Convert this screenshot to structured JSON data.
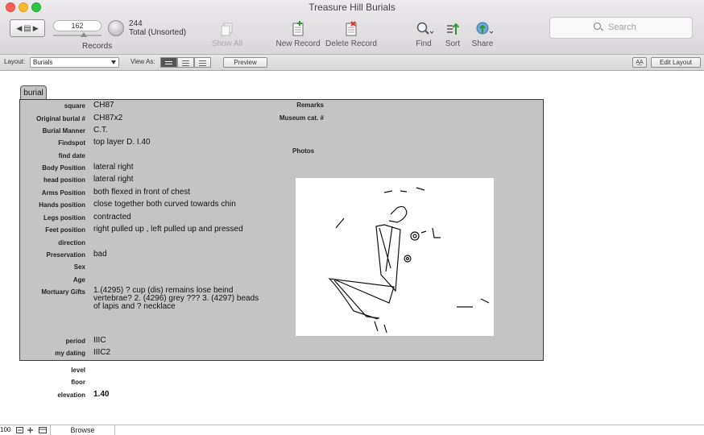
{
  "window": {
    "title": "Treasure Hill Burials"
  },
  "toolbar": {
    "current_record": "162",
    "found_count": "244",
    "found_status": "Total (Unsorted)",
    "records_label": "Records",
    "show_all_label": "Show All",
    "new_record_label": "New Record",
    "delete_record_label": "Delete Record",
    "find_label": "Find",
    "sort_label": "Sort",
    "share_label": "Share",
    "search_placeholder": "Search"
  },
  "layoutbar": {
    "layout_label": "Layout:",
    "layout_value": "Burials",
    "view_as_label": "View As:",
    "view_modes": [
      "form",
      "list",
      "table"
    ],
    "active_view": "form",
    "preview_label": "Preview",
    "aa_label": "A͟A",
    "edit_layout_label": "Edit Layout"
  },
  "tab": {
    "label": "burial"
  },
  "fields": [
    {
      "label": "square",
      "value": "CH87"
    },
    {
      "label": "Original burial #",
      "value": "CH87x2"
    },
    {
      "label": "Burial Manner",
      "value": "C.T."
    },
    {
      "label": "Findspot",
      "value": "top layer D. I.40"
    },
    {
      "label": "find date",
      "value": ""
    },
    {
      "label": "Body Position",
      "value": "lateral right"
    },
    {
      "label": "head position",
      "value": "lateral right"
    },
    {
      "label": "Arms Position",
      "value": "both flexed in front of chest"
    },
    {
      "label": "Hands position",
      "value": "close together both curved towards chin"
    },
    {
      "label": "Legs position",
      "value": "contracted"
    },
    {
      "label": "Feet position",
      "value": "right pulled up , left pulled up and pressed"
    },
    {
      "label": "direction",
      "value": ""
    },
    {
      "label": "Preservation",
      "value": "bad"
    },
    {
      "label": "Sex",
      "value": ""
    },
    {
      "label": "Age",
      "value": ""
    },
    {
      "label": "Mortuary Gifts",
      "value": "1.(4295) ? cup (dis) remains lose beind vertebrae? 2. (4296) grey ??? 3. (4297) beads of lapis and ? necklace"
    },
    {
      "label": "period",
      "value": "IIIC"
    },
    {
      "label": "my dating",
      "value": "IIIC2"
    },
    {
      "label": "level",
      "value": ""
    },
    {
      "label": "floor",
      "value": ""
    },
    {
      "label": "elevation",
      "value": "1.40"
    }
  ],
  "right_fields": {
    "remarks_label": "Remarks",
    "museum_label": "Museum cat. #",
    "photos_label": "Photos"
  },
  "statusbar": {
    "zoom": "100",
    "mode": "Browse"
  }
}
